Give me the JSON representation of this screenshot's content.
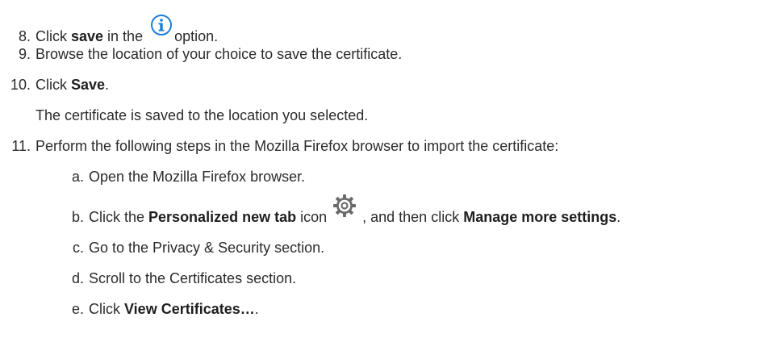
{
  "steps": {
    "s8": {
      "num": "8.",
      "t1": "Click ",
      "b1": "save",
      "t2": " in the ",
      "t3": "option.",
      "icon": "info-icon",
      "icon_color": "#1a7fd8"
    },
    "s9": {
      "num": "9.",
      "text": "Browse the location of your choice to save the certificate."
    },
    "s10": {
      "num": "10.",
      "t1": "Click ",
      "b1": "Save",
      "t2": ".",
      "note": "The certificate is saved to the location you selected."
    },
    "s11": {
      "num": "11.",
      "text": "Perform the following steps in the Mozilla Firefox browser to import the certificate:",
      "sub": {
        "a": {
          "num": "a.",
          "text": "Open the Mozilla Firefox browser."
        },
        "b": {
          "num": "b.",
          "t1": "Click the ",
          "b1": "Personalized new tab",
          "t2": " icon",
          "t3": ", and then click ",
          "b2": "Manage more settings",
          "t4": ".",
          "icon": "gear-icon",
          "icon_color": "#6b6b6b"
        },
        "c": {
          "num": "c.",
          "text": "Go to the Privacy & Security section."
        },
        "d": {
          "num": "d.",
          "text": "Scroll to the Certificates section."
        },
        "e": {
          "num": "e.",
          "t1": "Click ",
          "b1": "View Certificates…",
          "t2": "."
        }
      }
    }
  }
}
